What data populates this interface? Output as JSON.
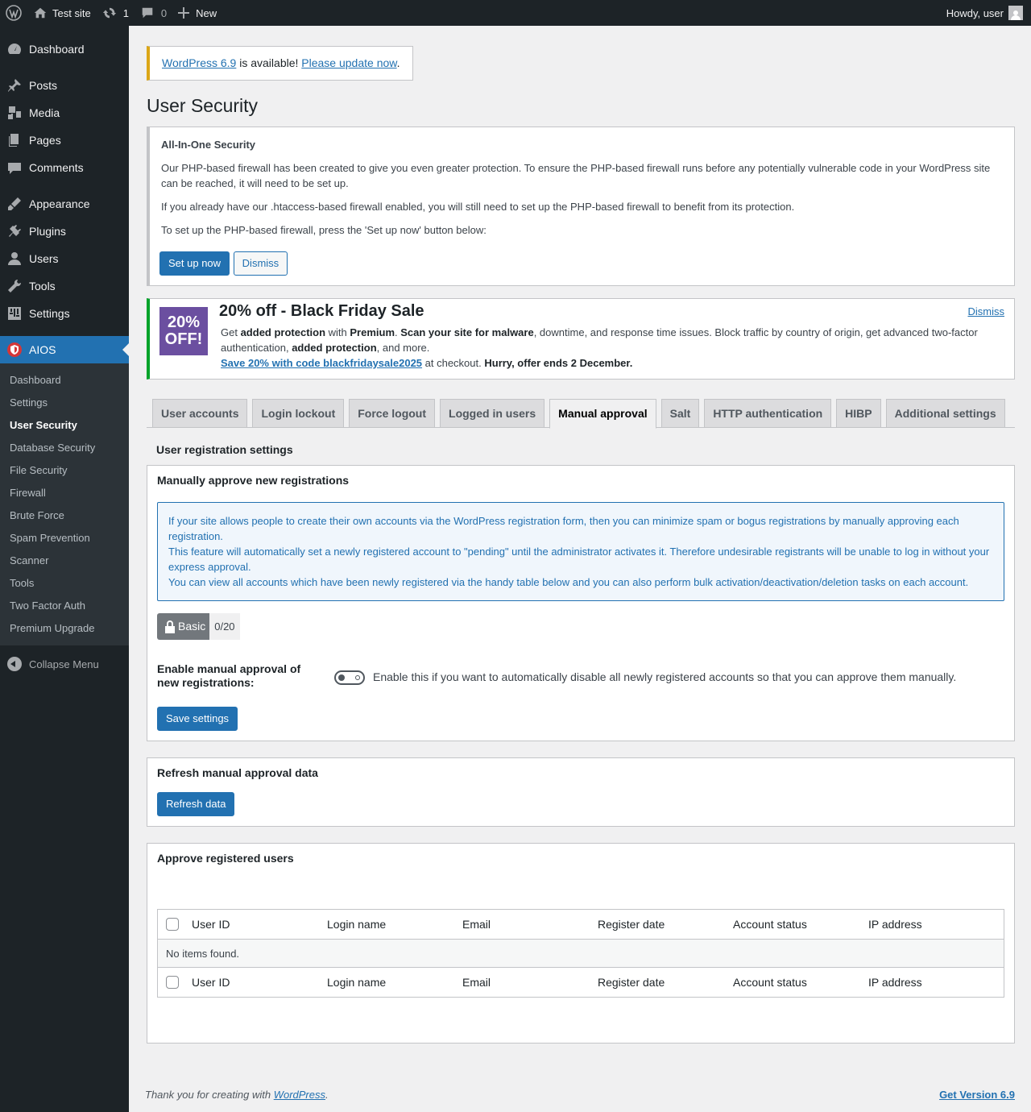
{
  "adminbar": {
    "site_name": "Test site",
    "updates_count": "1",
    "comments_count": "0",
    "new_label": "New",
    "howdy": "Howdy, user"
  },
  "sidebar": {
    "items": [
      {
        "label": "Dashboard",
        "icon": "dashboard-icon"
      },
      {
        "label": "Posts",
        "icon": "pin-icon"
      },
      {
        "label": "Media",
        "icon": "media-icon"
      },
      {
        "label": "Pages",
        "icon": "pages-icon"
      },
      {
        "label": "Comments",
        "icon": "comment-icon"
      },
      {
        "label": "Appearance",
        "icon": "brush-icon"
      },
      {
        "label": "Plugins",
        "icon": "plug-icon"
      },
      {
        "label": "Users",
        "icon": "user-icon"
      },
      {
        "label": "Tools",
        "icon": "wrench-icon"
      },
      {
        "label": "Settings",
        "icon": "settings-icon"
      },
      {
        "label": "AIOS",
        "icon": "shield-icon"
      }
    ],
    "submenu": [
      "Dashboard",
      "Settings",
      "User Security",
      "Database Security",
      "File Security",
      "Firewall",
      "Brute Force",
      "Spam Prevention",
      "Scanner",
      "Tools",
      "Two Factor Auth",
      "Premium Upgrade"
    ],
    "collapse_label": "Collapse Menu"
  },
  "update_nag": {
    "link_version": "WordPress 6.9",
    "middle": " is available! ",
    "link_update": "Please update now",
    "end": "."
  },
  "page_title": "User Security",
  "aios_notice": {
    "title": "All-In-One Security",
    "p1": "Our PHP-based firewall has been created to give you even greater protection. To ensure the PHP-based firewall runs before any potentially vulnerable code in your WordPress site can be reached, it will need to be set up.",
    "p2": "If you already have our .htaccess-based firewall enabled, you will still need to set up the PHP-based firewall to benefit from its protection.",
    "p3": "To set up the PHP-based firewall, press the 'Set up now' button below:",
    "setup_button": "Set up now",
    "dismiss_button": "Dismiss"
  },
  "black_friday": {
    "badge_line1": "20%",
    "badge_line2": "OFF!",
    "title": "20% off - Black Friday Sale",
    "dismiss": "Dismiss",
    "t1": "Get ",
    "b1": "added protection",
    "t2": " with ",
    "b2": "Premium",
    "t3": ". ",
    "b3": "Scan your site for malware",
    "t4": ", downtime, and response time issues. Block traffic by country of origin, get advanced two-factor authentication, ",
    "b4": "added protection",
    "t5": ", and more.",
    "code_link": "Save 20% with code blackfridaysale2025",
    "t6": " at checkout. ",
    "b5": "Hurry, offer ends 2 December."
  },
  "tabs": [
    "User accounts",
    "Login lockout",
    "Force logout",
    "Logged in users",
    "Manual approval",
    "Salt",
    "HTTP authentication",
    "HIBP",
    "Additional settings"
  ],
  "active_tab": "Manual approval",
  "section_heading": "User registration settings",
  "manual_box": {
    "title": "Manually approve new registrations",
    "info1": "If your site allows people to create their own accounts via the WordPress registration form, then you can minimize spam or bogus registrations by manually approving each registration.",
    "info2": "This feature will automatically set a newly registered account to \"pending\" until the administrator activates it. Therefore undesirable registrants will be unable to log in without your express approval.",
    "info3": "You can view all accounts which have been newly registered via the handy table below and you can also perform bulk activation/deactivation/deletion tasks on each account.",
    "badge_label": "Basic",
    "badge_score": "0/20",
    "toggle_label": "Enable manual approval of new registrations:",
    "toggle_desc": "Enable this if you want to automatically disable all newly registered accounts so that you can approve them manually.",
    "save_button": "Save settings"
  },
  "refresh_box": {
    "title": "Refresh manual approval data",
    "button": "Refresh data"
  },
  "approve_box": {
    "title": "Approve registered users",
    "columns": [
      "User ID",
      "Login name",
      "Email",
      "Register date",
      "Account status",
      "IP address"
    ],
    "empty": "No items found."
  },
  "footer": {
    "thanks_prefix": "Thank you for creating with ",
    "thanks_link": "WordPress",
    "thanks_suffix": ".",
    "version_link": "Get Version 6.9"
  }
}
